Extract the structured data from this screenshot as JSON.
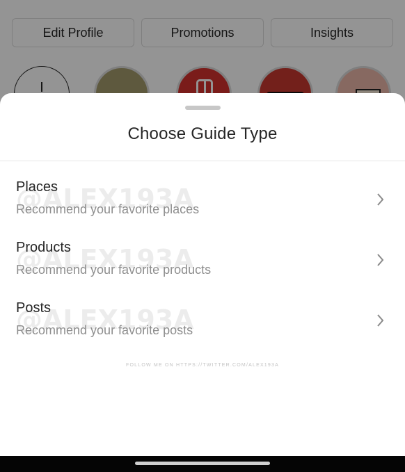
{
  "profile": {
    "buttons": {
      "edit_profile": "Edit Profile",
      "promotions": "Promotions",
      "insights": "Insights"
    }
  },
  "sheet": {
    "title": "Choose Guide Type",
    "options": [
      {
        "title": "Places",
        "description": "Recommend your favorite places",
        "icon": "chevron-right-icon"
      },
      {
        "title": "Products",
        "description": "Recommend your favorite products",
        "icon": "chevron-right-icon"
      },
      {
        "title": "Posts",
        "description": "Recommend your favorite posts",
        "icon": "chevron-right-icon"
      }
    ],
    "watermark": "@ALEX193A",
    "follow_note": "FOLLOW ME ON HTTPS://TWITTER.COM/ALEX193A"
  },
  "colors": {
    "text_primary": "#262626",
    "text_secondary": "#8e8e8e",
    "scrim": "rgba(0,0,0,0.42)"
  }
}
